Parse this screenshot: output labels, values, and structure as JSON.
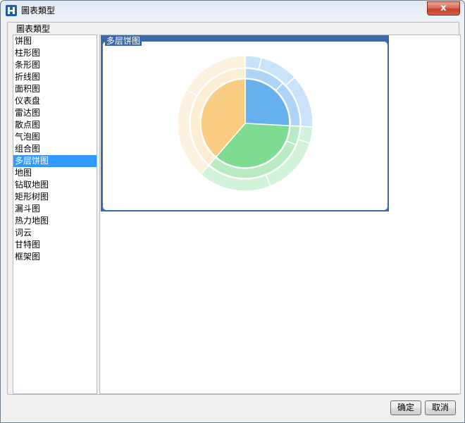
{
  "window": {
    "title": "圖表類型",
    "close_glyph": "x"
  },
  "group": {
    "legend": "圖表類型"
  },
  "chart_types": [
    "饼图",
    "柱形图",
    "条形图",
    "折线图",
    "面积图",
    "仪表盘",
    "雷达图",
    "散点图",
    "气泡图",
    "组合图",
    "多层饼图",
    "地图",
    "钻取地图",
    "矩形树图",
    "漏斗图",
    "热力地图",
    "词云",
    "甘特图",
    "框架图"
  ],
  "selected_index": 10,
  "preview": {
    "label": "多层饼图"
  },
  "buttons": {
    "ok": "确定",
    "cancel": "取消"
  },
  "colors": {
    "selection": "#3399ff",
    "preview_bg": "#3b6aa6",
    "blue": "#66b0ee",
    "green": "#7ddb92",
    "orange": "#f8cc81"
  }
}
